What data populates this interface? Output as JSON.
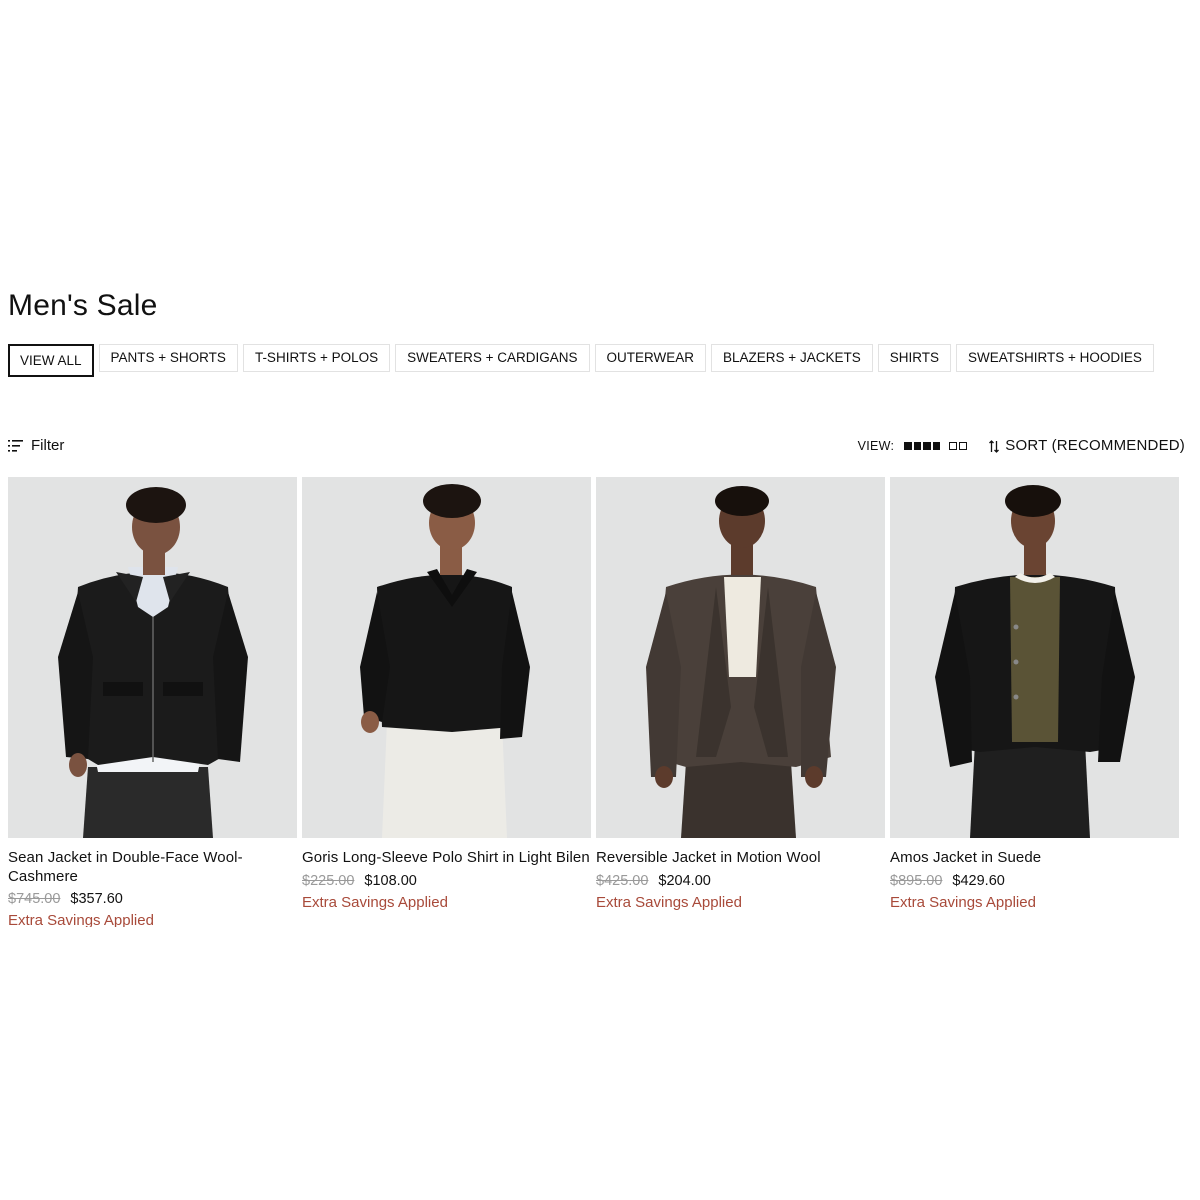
{
  "page": {
    "title": "Men's Sale"
  },
  "categories": [
    {
      "label": "VIEW ALL",
      "active": true
    },
    {
      "label": "PANTS + SHORTS",
      "active": false
    },
    {
      "label": "T-SHIRTS + POLOS",
      "active": false
    },
    {
      "label": "SWEATERS + CARDIGANS",
      "active": false
    },
    {
      "label": "OUTERWEAR",
      "active": false
    },
    {
      "label": "BLAZERS + JACKETS",
      "active": false
    },
    {
      "label": "SHIRTS",
      "active": false
    },
    {
      "label": "SWEATSHIRTS + HOODIES",
      "active": false
    }
  ],
  "toolbar": {
    "filter_label": "Filter",
    "view_label": "VIEW:",
    "sort_label": "SORT (RECOMMENDED)"
  },
  "products": [
    {
      "name": "Sean Jacket in Double-Face Wool-Cashmere",
      "original_price": "$745.00",
      "sale_price": "$357.60",
      "savings": "Extra Savings Applied"
    },
    {
      "name": "Goris Long-Sleeve Polo Shirt in Light Bilen",
      "original_price": "$225.00",
      "sale_price": "$108.00",
      "savings": "Extra Savings Applied"
    },
    {
      "name": "Reversible Jacket in Motion Wool",
      "original_price": "$425.00",
      "sale_price": "$204.00",
      "savings": "Extra Savings Applied"
    },
    {
      "name": "Amos Jacket in Suede",
      "original_price": "$895.00",
      "sale_price": "$429.60",
      "savings": "Extra Savings Applied"
    }
  ],
  "colors": {
    "savings_text": "#a84a3a",
    "original_price": "#9a9a9a",
    "image_background": "#e2e3e3"
  }
}
